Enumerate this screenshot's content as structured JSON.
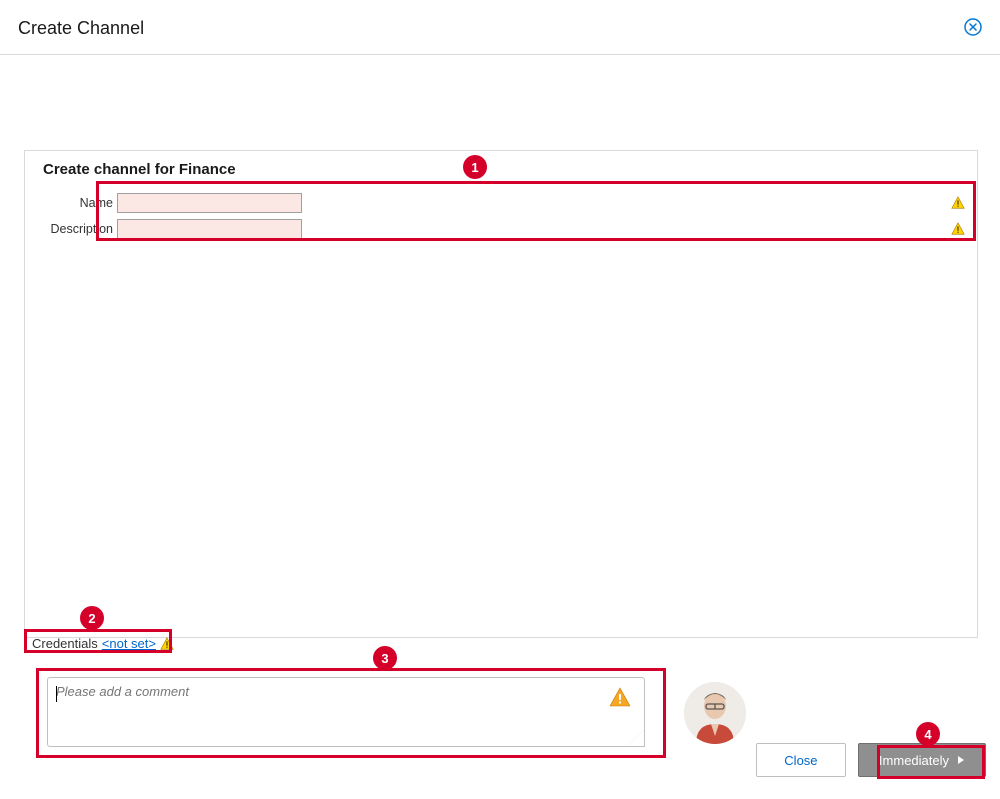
{
  "header": {
    "title": "Create Channel"
  },
  "panel": {
    "title": "Create channel for Finance",
    "name_label": "Name",
    "name_value": "",
    "desc_label": "Description",
    "desc_value": ""
  },
  "credentials": {
    "label": "Credentials",
    "value": "<not set>"
  },
  "comment": {
    "placeholder": "Please add a comment",
    "value": ""
  },
  "buttons": {
    "close": "Close",
    "immediately": "Immediately"
  },
  "annotations": {
    "m1": "1",
    "m2": "2",
    "m3": "3",
    "m4": "4"
  },
  "icons": {
    "close_x": "close-x",
    "warning": "warning-triangle",
    "chevron": "chevron-right"
  }
}
